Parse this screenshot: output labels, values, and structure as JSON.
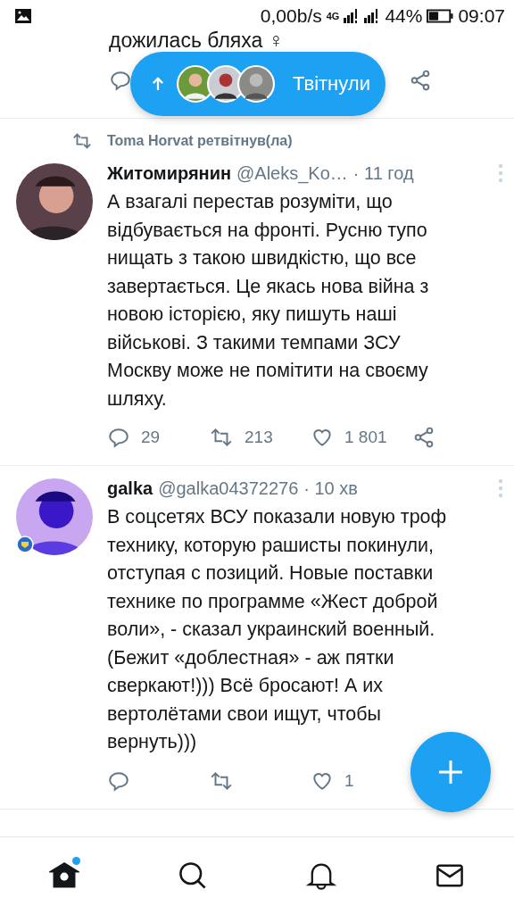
{
  "status_bar": {
    "speed": "0,00b/s",
    "network": "4G",
    "battery": "44%",
    "time": "09:07"
  },
  "prev_tweet": {
    "text": "дожилась бляха ♀"
  },
  "new_tweets_pill": {
    "label": "Твітнули"
  },
  "tweets": [
    {
      "retweeted_by": "Toma Horvat ретвітнув(ла)",
      "name": "Житомирянин",
      "handle": "@Aleks_Ko…",
      "time": "· 11 год",
      "avatar_badge": false,
      "text": "А взагалі перестав розуміти, що\nвідбувається на фронті. Русню тупо\nнищать з такою швидкістю, що все\nзавертається. Це якась нова війна з\nновою історією, яку пишуть наші\nвійськові. З такими темпами ЗСУ\nМоскву може не помітити на своєму\nшляху.",
      "replies": "29",
      "retweets": "213",
      "likes": "1 801"
    },
    {
      "name": "galka",
      "handle": "@galka04372276",
      "time": "· 10 хв",
      "avatar_badge": true,
      "text": "В соцсетях ВСУ показали новую троф\nтехнику, которую рашисты покинули,\nотступая с позиций. Новые поставки\nтехнике по программе «Жест доброй\nволи», - сказал украинский военный.\n(Бежит «доблестная» - аж пятки\nсверкают!))) Всё бросают! А их\nвертолётами свои ищут, чтобы\nвернуть)))",
      "likes": "1"
    }
  ],
  "nav": [
    {
      "kind": "home",
      "selected": true,
      "badge": true
    },
    {
      "kind": "search",
      "selected": false,
      "badge": false
    },
    {
      "kind": "bell",
      "selected": false,
      "badge": false
    },
    {
      "kind": "mail",
      "selected": false,
      "badge": false
    }
  ]
}
